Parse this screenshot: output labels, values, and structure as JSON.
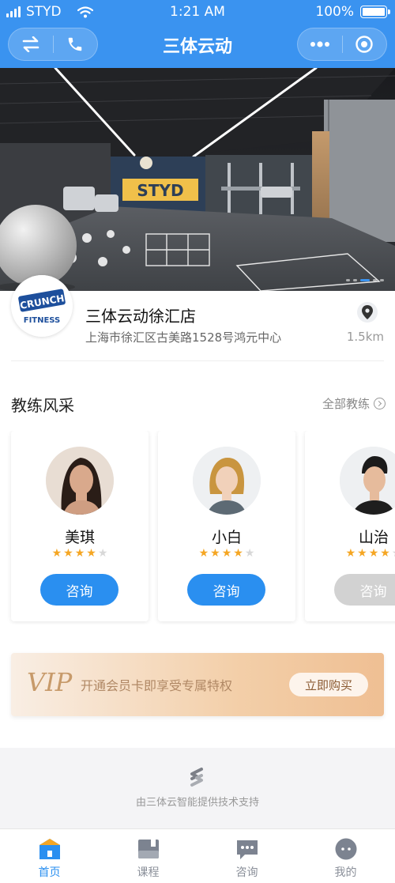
{
  "status_bar": {
    "carrier": "STYD",
    "time": "1:21 AM",
    "battery": "100%"
  },
  "nav": {
    "title": "三体云动",
    "left_icons": [
      "swap-icon",
      "phone-icon"
    ],
    "right_icons": [
      "more-dots-icon",
      "target-icon"
    ]
  },
  "banner": {
    "wall_text": "STYD",
    "slide_count": 5,
    "active_slide": 3
  },
  "store": {
    "logo_text_top": "CRUNCH",
    "logo_text_bottom": "FITNESS",
    "name": "三体云动徐汇店",
    "address": "上海市徐汇区古美路1528号鸿元中心",
    "distance": "1.5km"
  },
  "coaches_section": {
    "title": "教练风采",
    "all_link": "全部教练",
    "coaches": [
      {
        "name": "美琪",
        "rating": 4,
        "max_rating": 5,
        "button": "咨询",
        "enabled": true
      },
      {
        "name": "小白",
        "rating": 4,
        "max_rating": 5,
        "button": "咨询",
        "enabled": true
      },
      {
        "name": "山治",
        "rating": 4,
        "max_rating": 5,
        "button": "咨询",
        "enabled": false
      }
    ]
  },
  "vip_banner": {
    "vip_label": "VIP",
    "text": "开通会员卡即享受专属特权",
    "button": "立即购买"
  },
  "footer": {
    "powered_by": "由三体云智能提供技术支持"
  },
  "tabbar": {
    "tabs": [
      {
        "label": "首页",
        "icon": "home-icon",
        "active": true
      },
      {
        "label": "课程",
        "icon": "course-icon",
        "active": false
      },
      {
        "label": "咨询",
        "icon": "chat-icon",
        "active": false
      },
      {
        "label": "我的",
        "icon": "profile-icon",
        "active": false
      }
    ]
  },
  "colors": {
    "primary": "#3a93f0",
    "button_blue": "#2a8ff0",
    "star": "#f5a623",
    "vip_gold": "#c79a6a"
  }
}
